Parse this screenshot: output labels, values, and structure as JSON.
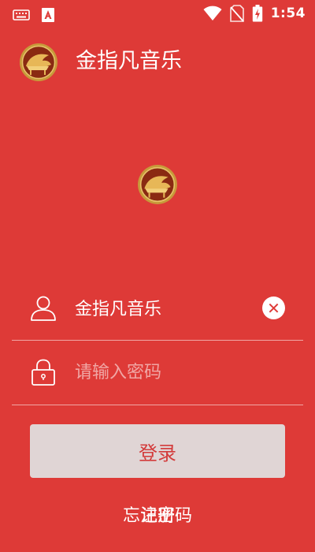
{
  "status_bar": {
    "time": "1:54",
    "left_icons": [
      "keyboard-icon",
      "app-notification-icon"
    ],
    "right_icons": [
      "wifi-icon",
      "no-sim-icon",
      "battery-charging-icon"
    ]
  },
  "app_bar": {
    "title": "金指凡音乐",
    "logo": "piano-logo-icon"
  },
  "login_form": {
    "username": {
      "value": "金指凡音乐",
      "icon": "user-icon",
      "clear_icon": "clear-icon",
      "clear_glyph": "✕"
    },
    "password": {
      "placeholder": "请输入密码",
      "icon": "lock-icon"
    },
    "login_button": "登录"
  },
  "bottom_links": {
    "forgot_password": "忘记密码",
    "register": "注册"
  },
  "colors": {
    "background": "#de3a37",
    "button_background": "#e0d5d5",
    "button_text": "#d33b3b",
    "text": "#ffffff"
  }
}
